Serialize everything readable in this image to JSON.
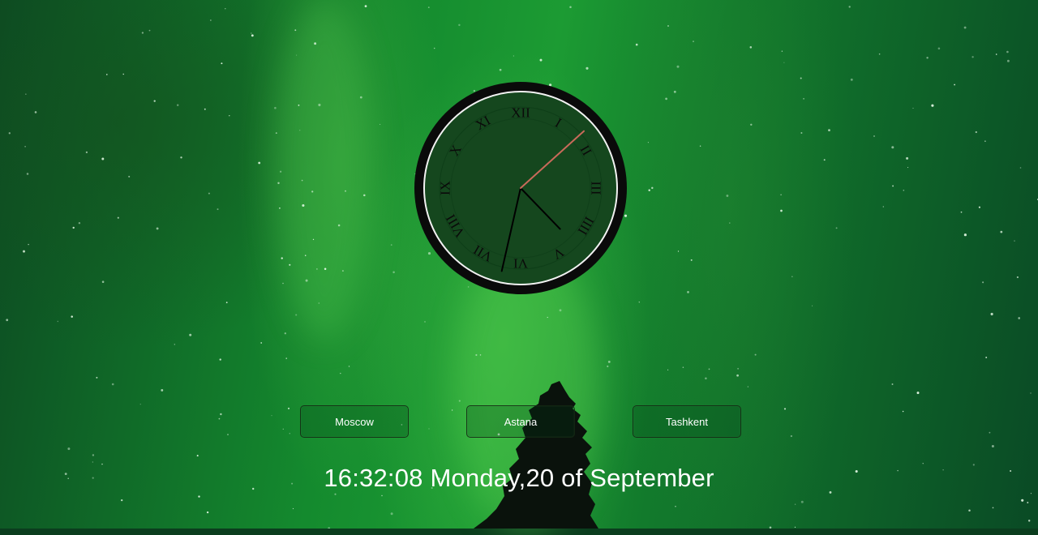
{
  "clock": {
    "numerals": [
      "XII",
      "I",
      "II",
      "III",
      "IIII",
      "V",
      "VI",
      "VII",
      "VIII",
      "IX",
      "X",
      "XI"
    ],
    "time": {
      "hours": 16,
      "minutes": 32,
      "seconds": 8
    },
    "colors": {
      "bezel": "#0a0a0a",
      "ring": "#f2f2f2",
      "numerals": "#0a0a0a",
      "hour_hand": "#000000",
      "minute_hand": "#000000",
      "second_hand": "#c96a5a"
    }
  },
  "cities": [
    {
      "label": "Moscow"
    },
    {
      "label": "Astana"
    },
    {
      "label": "Tashkent"
    }
  ],
  "datetime": {
    "time": "16:32:08",
    "date": "Monday,20 of September"
  }
}
